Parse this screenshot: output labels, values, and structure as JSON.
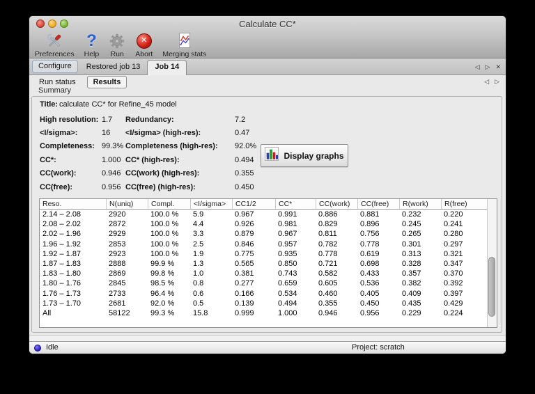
{
  "window": {
    "title": "Calculate CC*"
  },
  "toolbar": {
    "items": [
      {
        "label": "Preferences",
        "icon": "tools-icon"
      },
      {
        "label": "Help",
        "icon": "help-icon"
      },
      {
        "label": "Run",
        "icon": "gear-icon"
      },
      {
        "label": "Abort",
        "icon": "abort-icon"
      },
      {
        "label": "Merging stats",
        "icon": "merging-stats-icon"
      }
    ]
  },
  "tabs": {
    "items": [
      {
        "label": "Configure",
        "selected": false
      },
      {
        "label": "Restored job 13",
        "selected": false
      },
      {
        "label": "Job 14",
        "selected": true
      }
    ],
    "nav": {
      "prev": "◁",
      "next": "▷",
      "close": "✕"
    }
  },
  "subtabs": {
    "items": [
      {
        "label": "Run status",
        "selected": false
      },
      {
        "label": "Results",
        "selected": true
      }
    ],
    "nav": {
      "prev": "◁",
      "next": "▷"
    }
  },
  "summary": {
    "group_label": "Summary",
    "title_label": "Title:",
    "title_value": "calculate CC* for Refine_45 model",
    "rows": [
      {
        "label1": "High resolution:",
        "value1": "1.7",
        "label2": "Redundancy:",
        "value2": "7.2"
      },
      {
        "label1": "<I/sigma>:",
        "value1": "16",
        "label2": "<I/sigma> (high-res):",
        "value2": "0.47"
      },
      {
        "label1": "Completeness:",
        "value1": "99.3%",
        "label2": "Completeness (high-res):",
        "value2": "92.0%"
      },
      {
        "label1": "CC*:",
        "value1": "1.000",
        "label2": "CC* (high-res):",
        "value2": "0.494"
      },
      {
        "label1": "CC(work):",
        "value1": "0.946",
        "label2": "CC(work) (high-res):",
        "value2": "0.355"
      },
      {
        "label1": "CC(free):",
        "value1": "0.956",
        "label2": "CC(free) (high-res):",
        "value2": "0.450"
      }
    ],
    "display_graphs_label": "Display graphs",
    "display_graphs_icon": "bar-chart-icon"
  },
  "table": {
    "headers": [
      "Reso.",
      "N(uniq)",
      "Compl.",
      "<I/sigma>",
      "CC1/2",
      "CC*",
      "CC(work)",
      "CC(free)",
      "R(work)",
      "R(free)"
    ],
    "rows": [
      [
        "2.14 – 2.08",
        "2920",
        "100.0 %",
        "5.9",
        "0.967",
        "0.991",
        "0.886",
        "0.881",
        "0.232",
        "0.220"
      ],
      [
        "2.08 – 2.02",
        "2872",
        "100.0 %",
        "4.4",
        "0.926",
        "0.981",
        "0.829",
        "0.896",
        "0.245",
        "0.241"
      ],
      [
        "2.02 – 1.96",
        "2929",
        "100.0 %",
        "3.3",
        "0.879",
        "0.967",
        "0.811",
        "0.756",
        "0.265",
        "0.280"
      ],
      [
        "1.96 – 1.92",
        "2853",
        "100.0 %",
        "2.5",
        "0.846",
        "0.957",
        "0.782",
        "0.778",
        "0.301",
        "0.297"
      ],
      [
        "1.92 – 1.87",
        "2923",
        "100.0 %",
        "1.9",
        "0.775",
        "0.935",
        "0.778",
        "0.619",
        "0.313",
        "0.321"
      ],
      [
        "1.87 – 1.83",
        "2888",
        "99.9 %",
        "1.3",
        "0.565",
        "0.850",
        "0.721",
        "0.698",
        "0.328",
        "0.347"
      ],
      [
        "1.83 – 1.80",
        "2869",
        "99.8 %",
        "1.0",
        "0.381",
        "0.743",
        "0.582",
        "0.433",
        "0.357",
        "0.370"
      ],
      [
        "1.80 – 1.76",
        "2845",
        "98.5 %",
        "0.8",
        "0.277",
        "0.659",
        "0.605",
        "0.536",
        "0.382",
        "0.392"
      ],
      [
        "1.76 – 1.73",
        "2733",
        "96.4 %",
        "0.6",
        "0.166",
        "0.534",
        "0.460",
        "0.405",
        "0.409",
        "0.397"
      ],
      [
        "1.73 – 1.70",
        "2681",
        "92.0 %",
        "0.5",
        "0.139",
        "0.494",
        "0.355",
        "0.450",
        "0.435",
        "0.429"
      ],
      [
        "All",
        "58122",
        "99.3 %",
        "15.8",
        "0.999",
        "1.000",
        "0.946",
        "0.956",
        "0.229",
        "0.224"
      ]
    ]
  },
  "statusbar": {
    "status": "Idle",
    "project": "Project: scratch"
  },
  "colors": {
    "abort_red": "#cf1e12",
    "help_blue": "#2a5fd0",
    "led_blue": "#3322cd",
    "traffic_red": "#dd4a3d",
    "traffic_yellow": "#efa91f",
    "traffic_green": "#79b52f"
  }
}
